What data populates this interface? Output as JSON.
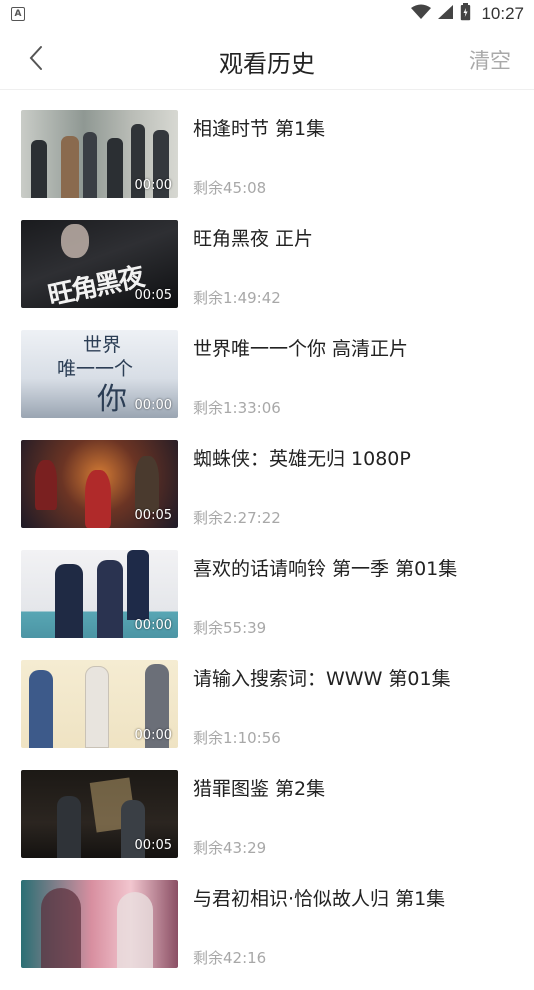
{
  "status": {
    "app_icon": "A",
    "time": "10:27",
    "icons": [
      "wifi-icon",
      "cellular-signal-icon",
      "battery-icon"
    ]
  },
  "header": {
    "title": "观看历史",
    "clear_label": "清空",
    "back_icon": "chevron-left-icon"
  },
  "history": [
    {
      "title": "相逢时节 第1集",
      "remaining": "剩余45:08",
      "duration": "00:00"
    },
    {
      "title": "旺角黑夜 正片",
      "remaining": "剩余1:49:42",
      "duration": "00:05"
    },
    {
      "title": "世界唯一一个你 高清正片",
      "remaining": "剩余1:33:06",
      "duration": "00:00"
    },
    {
      "title": "蜘蛛侠：英雄无归 1080P",
      "remaining": "剩余2:27:22",
      "duration": "00:05"
    },
    {
      "title": "喜欢的话请响铃 第一季 第01集",
      "remaining": "剩余55:39",
      "duration": "00:00"
    },
    {
      "title": "请输入搜索词：WWW 第01集",
      "remaining": "剩余1:10:56",
      "duration": "00:00"
    },
    {
      "title": "猎罪图鉴 第2集",
      "remaining": "剩余43:29",
      "duration": "00:05"
    },
    {
      "title": "与君初相识·恰似故人归 第1集",
      "remaining": "剩余42:16",
      "duration": ""
    }
  ],
  "poster_text": {
    "poster_2": "旺角黑夜",
    "poster_3_line1": "世界",
    "poster_3_line2": "唯一一个",
    "poster_3_line3": "你"
  },
  "colors": {
    "title": "#222222",
    "secondary": "#a8a8a8",
    "clear": "#a9a9a9"
  }
}
